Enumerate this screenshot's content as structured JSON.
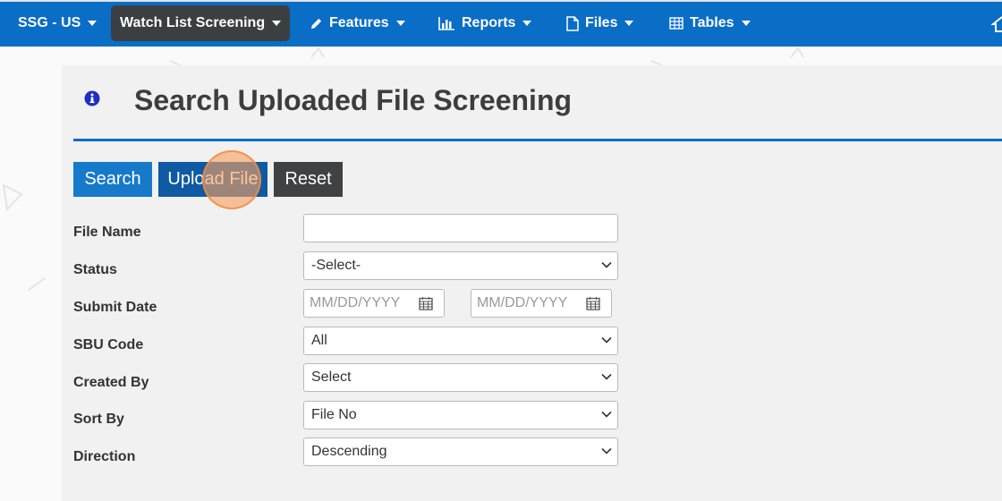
{
  "nav": {
    "brand": "SSG - US",
    "items": [
      {
        "label": "Watch List Screening",
        "icon": "",
        "active": true
      },
      {
        "label": "Features",
        "icon": "pencil-icon"
      },
      {
        "label": "Reports",
        "icon": "bar-chart-icon"
      },
      {
        "label": "Files",
        "icon": "file-icon"
      },
      {
        "label": "Tables",
        "icon": "table-icon"
      }
    ]
  },
  "page": {
    "title": "Search Uploaded File Screening"
  },
  "buttons": {
    "search": "Search",
    "upload": "Upload File",
    "reset": "Reset"
  },
  "form": {
    "file_name": {
      "label": "File Name",
      "value": ""
    },
    "status": {
      "label": "Status",
      "value": "-Select-"
    },
    "submit_date": {
      "label": "Submit Date",
      "from_placeholder": "MM/DD/YYYY",
      "to_placeholder": "MM/DD/YYYY"
    },
    "sbu_code": {
      "label": "SBU Code",
      "value": "All"
    },
    "created_by": {
      "label": "Created By",
      "value": "Select"
    },
    "sort_by": {
      "label": "Sort By",
      "value": "File No"
    },
    "direction": {
      "label": "Direction",
      "value": "Descending"
    }
  },
  "colors": {
    "navbar": "#0a6dc6",
    "active_nav": "#3c3f41",
    "primary_button": "#1779c9",
    "upload_button": "#0f5aa3",
    "reset_button": "#3f4142",
    "click_highlight": "#f7a05f"
  }
}
